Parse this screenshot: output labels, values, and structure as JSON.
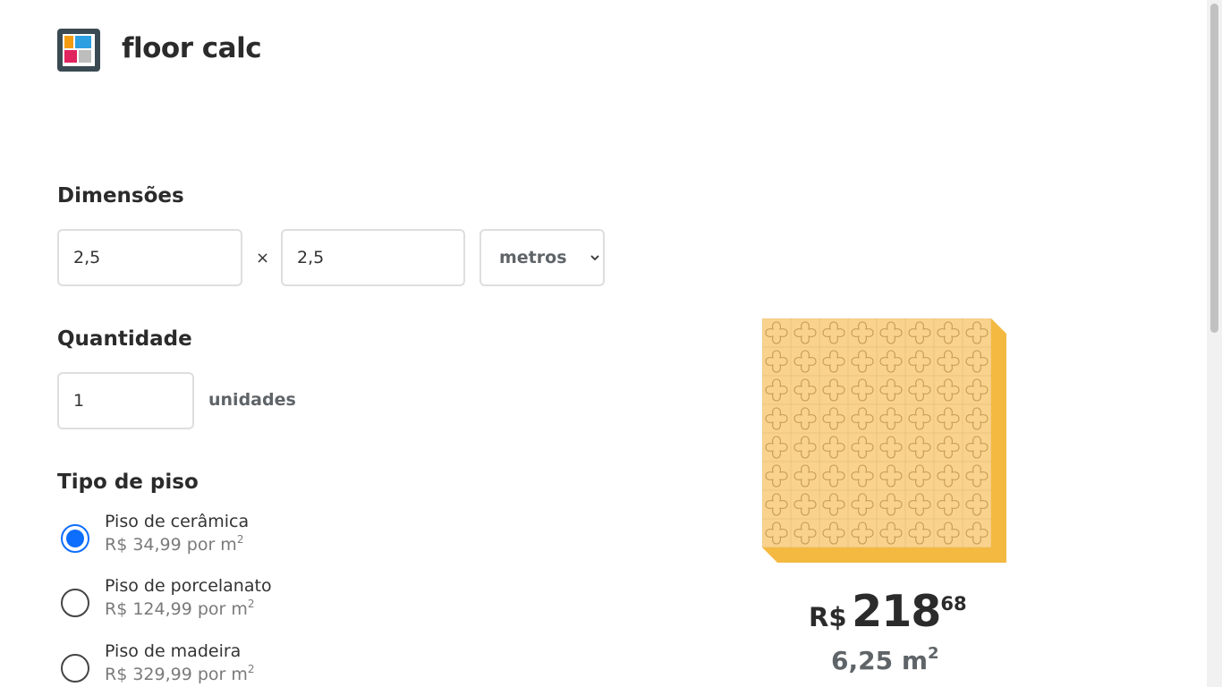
{
  "header": {
    "brand": "floor calc"
  },
  "dimensions": {
    "title": "Dimensões",
    "width_value": "2,5",
    "separator": "×",
    "length_value": "2,5",
    "unit_selected": "metros"
  },
  "quantity": {
    "title": "Quantidade",
    "value": "1",
    "unit_label": "unidades"
  },
  "floor_type": {
    "title": "Tipo de piso",
    "options": [
      {
        "label": "Piso de cerâmica",
        "price": "R$ 34,99 por m",
        "exp": "2",
        "selected": true
      },
      {
        "label": "Piso de porcelanato",
        "price": "R$ 124,99 por m",
        "exp": "2",
        "selected": false
      },
      {
        "label": "Piso de madeira",
        "price": "R$ 329,99 por m",
        "exp": "2",
        "selected": false
      }
    ]
  },
  "result": {
    "currency": "R$",
    "integer": "218",
    "cents": "68",
    "area": "6,25 m",
    "area_exp": "2"
  },
  "colors": {
    "accent": "#0d6efd",
    "tile_face": "#f9d38d",
    "tile_side": "#f3b941",
    "tile_pattern": "#c59a55"
  }
}
